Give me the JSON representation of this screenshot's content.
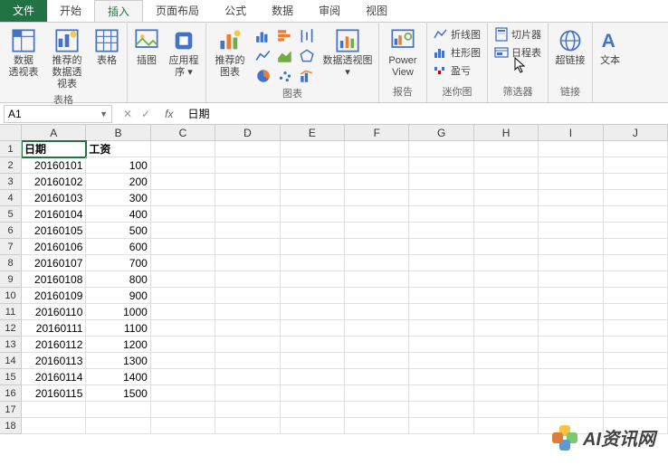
{
  "tabs": {
    "file": "文件",
    "home": "开始",
    "insert": "插入",
    "layout": "页面布局",
    "formula": "公式",
    "data": "数据",
    "review": "审阅",
    "view": "视图"
  },
  "ribbon": {
    "tables_group": "表格",
    "pivot": "数据\n透视表",
    "recpivot": "推荐的\n数据透视表",
    "table": "表格",
    "illus": "插图",
    "addon": "应用程\n序 ▾",
    "reccharts": "推荐的\n图表",
    "charts_group": "图表",
    "pivotchart": "数据透视图\n▾",
    "report_group": "报告",
    "powerview": "Power\nView",
    "spark_group": "迷你图",
    "sparkline_line": "折线图",
    "sparkline_col": "柱形图",
    "sparkline_wl": "盈亏",
    "filter_group": "筛选器",
    "slicer": "切片器",
    "timeline": "日程表",
    "link_group": "链接",
    "hyperlink": "超链接",
    "textbtn": "文本"
  },
  "formula_bar": {
    "namebox": "A1",
    "content": "日期"
  },
  "grid": {
    "cols": [
      "A",
      "B",
      "C",
      "D",
      "E",
      "F",
      "G",
      "H",
      "I",
      "J"
    ],
    "rows": [
      "1",
      "2",
      "3",
      "4",
      "5",
      "6",
      "7",
      "8",
      "9",
      "10",
      "11",
      "12",
      "13",
      "14",
      "15",
      "16",
      "17",
      "18"
    ],
    "header": {
      "a": "日期",
      "b": "工资"
    },
    "data": [
      {
        "a": "20160101",
        "b": "100"
      },
      {
        "a": "20160102",
        "b": "200"
      },
      {
        "a": "20160103",
        "b": "300"
      },
      {
        "a": "20160104",
        "b": "400"
      },
      {
        "a": "20160105",
        "b": "500"
      },
      {
        "a": "20160106",
        "b": "600"
      },
      {
        "a": "20160107",
        "b": "700"
      },
      {
        "a": "20160108",
        "b": "800"
      },
      {
        "a": "20160109",
        "b": "900"
      },
      {
        "a": "20160110",
        "b": "1000"
      },
      {
        "a": "20160111",
        "b": "1100"
      },
      {
        "a": "20160112",
        "b": "1200"
      },
      {
        "a": "20160113",
        "b": "1300"
      },
      {
        "a": "20160114",
        "b": "1400"
      },
      {
        "a": "20160115",
        "b": "1500"
      }
    ]
  },
  "watermark": "AI资讯网"
}
